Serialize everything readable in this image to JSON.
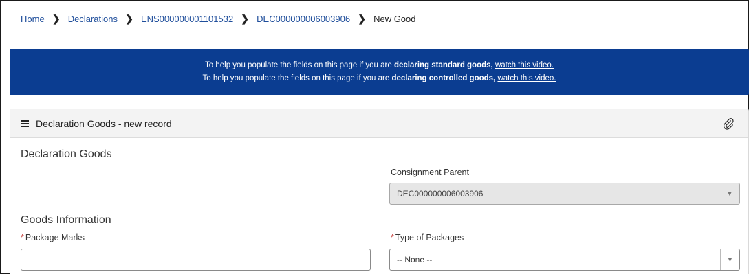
{
  "breadcrumb": {
    "items": [
      "Home",
      "Declarations",
      "ENS000000001101532",
      "DEC000000006003906"
    ],
    "current": "New Good"
  },
  "banner": {
    "line1_prefix": "To help you populate the fields on this page if you are ",
    "line1_bold": "declaring standard goods,",
    "line1_link": "watch this video.",
    "line2_prefix": "To help you populate the fields on this page if you are ",
    "line2_bold": "declaring controlled goods,",
    "line2_link": "watch this video.",
    "background_color": "#0b3d91"
  },
  "panel": {
    "title": "Declaration Goods - new record",
    "section1_title": "Declaration Goods",
    "consignment_parent_label": "Consignment Parent",
    "consignment_parent_value": "DEC000000006003906",
    "section2_title": "Goods Information",
    "package_marks_label": "Package Marks",
    "package_marks_value": "",
    "type_of_packages_label": "Type of Packages",
    "type_of_packages_value": "-- None --",
    "required_mark": "*"
  },
  "icons": {
    "breadcrumb_separator": "chevron-right-icon",
    "menu": "hamburger-menu-icon",
    "attachment": "paperclip-icon",
    "dropdown": "chevron-down-icon"
  },
  "colors": {
    "link": "#1f4e9b",
    "required": "#c23934"
  }
}
